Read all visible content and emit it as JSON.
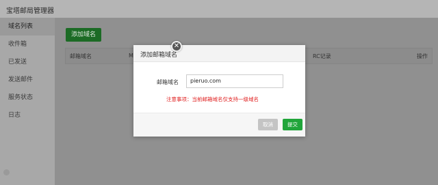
{
  "app": {
    "title": "宝塔邮局管理器"
  },
  "sidebar": {
    "items": [
      {
        "label": "域名列表"
      },
      {
        "label": "收件箱"
      },
      {
        "label": "已发送"
      },
      {
        "label": "发送邮件"
      },
      {
        "label": "服务状态"
      },
      {
        "label": "日志"
      }
    ]
  },
  "main": {
    "add_button": "添加域名",
    "table": {
      "headers": [
        "邮箱域名",
        "M",
        "RC记录",
        "操作"
      ]
    }
  },
  "dialog": {
    "title": "添加邮箱域名",
    "close_glyph": "✕",
    "field_label": "邮箱域名",
    "field_value": "pieruo.com",
    "notice": "注意事项：当前邮箱域名仅支持一级域名",
    "cancel": "取消",
    "submit": "提交"
  },
  "colors": {
    "accent": "#20a53a",
    "notice": "#e02020"
  }
}
